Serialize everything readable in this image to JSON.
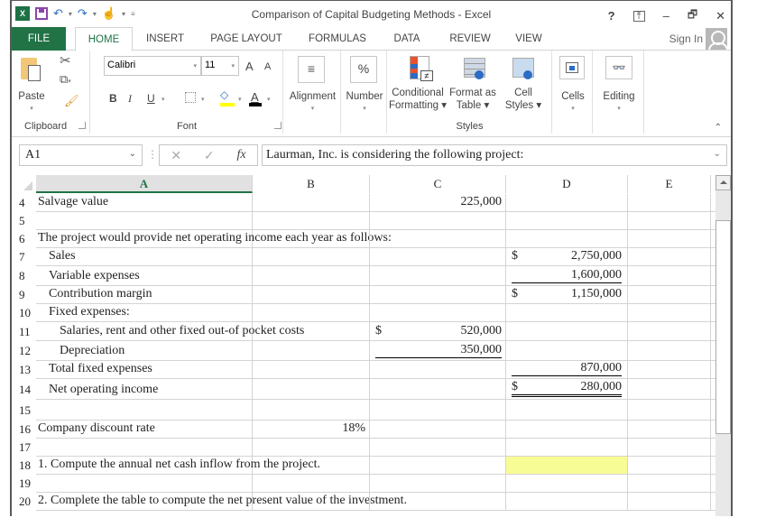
{
  "app": {
    "title": "Comparison of Capital Budgeting Methods - Excel",
    "window_controls": [
      "?",
      "⤒",
      "–",
      "🗗",
      "✕"
    ]
  },
  "quick_access": {
    "logo": "X",
    "icons": [
      "excel-logo-icon",
      "save-icon",
      "undo-icon",
      "redo-icon",
      "touch-mode-icon",
      "customize-qat-icon"
    ]
  },
  "tabs": [
    {
      "label": "FILE",
      "active": false
    },
    {
      "label": "HOME",
      "active": true
    },
    {
      "label": "INSERT",
      "active": false
    },
    {
      "label": "PAGE LAYOUT",
      "active": false
    },
    {
      "label": "FORMULAS",
      "active": false
    },
    {
      "label": "DATA",
      "active": false
    },
    {
      "label": "REVIEW",
      "active": false
    },
    {
      "label": "VIEW",
      "active": false
    }
  ],
  "sign_in": "Sign In",
  "ribbon": {
    "clipboard": {
      "label": "Clipboard",
      "paste": "Paste"
    },
    "font": {
      "label": "Font",
      "font_name": "Calibri",
      "font_size": "11",
      "bold": "B",
      "italic": "I",
      "underline": "U",
      "grow": "A",
      "shrink": "A",
      "font_color": "A",
      "highlight_color": "#ffff00",
      "text_color": "#000000"
    },
    "alignment": {
      "label": "Alignment"
    },
    "number": {
      "label": "Number",
      "icon_text": "%"
    },
    "styles": {
      "label": "Styles",
      "conditional_formatting": [
        "Conditional",
        "Formatting ▾"
      ],
      "format_as_table": [
        "Format as",
        "Table ▾"
      ],
      "cell_styles": [
        "Cell",
        "Styles ▾"
      ]
    },
    "cells": {
      "label": "Cells"
    },
    "editing": {
      "label": "Editing"
    }
  },
  "formula_bar": {
    "name_box": "A1",
    "fx": "fx",
    "content": "Laurman, Inc. is considering the following project:"
  },
  "sheet": {
    "columns": [
      "A",
      "B",
      "C",
      "D",
      "E"
    ],
    "selected_column": "A",
    "rows": [
      {
        "num": "4",
        "A": "Salvage value",
        "C": "225,000"
      },
      {
        "num": "5"
      },
      {
        "num": "6",
        "A": "The project would provide net operating income each year as follows:"
      },
      {
        "num": "7",
        "A": "Sales",
        "D_dollar": "$",
        "D": "2,750,000"
      },
      {
        "num": "8",
        "A": "Variable expenses",
        "D": "1,600,000"
      },
      {
        "num": "9",
        "A": "Contribution margin",
        "D_dollar": "$",
        "D": "1,150,000"
      },
      {
        "num": "10",
        "A": "Fixed expenses:"
      },
      {
        "num": "11",
        "A": "Salaries, rent and other fixed out-of pocket costs",
        "C_dollar": "$",
        "C": "520,000"
      },
      {
        "num": "12",
        "A": "Depreciation",
        "C": "350,000"
      },
      {
        "num": "13",
        "A": "Total fixed expenses",
        "D": "870,000"
      },
      {
        "num": "14",
        "A": "Net operating income",
        "D_dollar": "$",
        "D": "280,000"
      },
      {
        "num": "15"
      },
      {
        "num": "16",
        "A": "Company discount rate",
        "B": "18%"
      },
      {
        "num": "17"
      },
      {
        "num": "18",
        "A": "1. Compute the annual net cash inflow from the project."
      },
      {
        "num": "19"
      },
      {
        "num": "20",
        "A": "2. Complete the table to compute the net present value of the investment."
      }
    ],
    "input_cell_color": "#f8fc94"
  }
}
